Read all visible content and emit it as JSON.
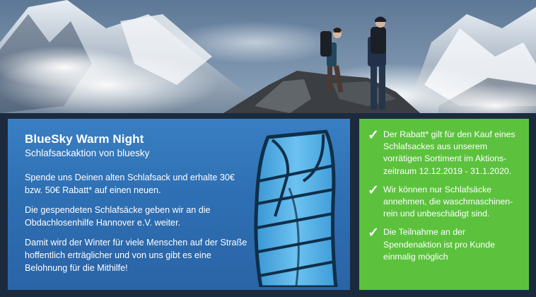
{
  "banner": {
    "title": "BlueSky Warm Night",
    "subtitle": "Schlafsackaktion von bluesky",
    "paragraph_1": "Spende uns Deinen alten Schlafsack und erhalte 30€ bzw. 50€ Rabatt* auf einen neuen.",
    "paragraph_2": "Die gespendeten Schlafsäcke geben wir an die Obdachlosenhilfe Hannover e.V. weiter.",
    "paragraph_3": "Damit wird der Winter für viele Menschen auf der Straße hoffentlich erträglicher und von uns gibt es eine Belohnung für die Mithilfe!"
  },
  "conditions": {
    "check_glyph": "✓",
    "items": [
      "Der Rabatt* gilt für den Kauf eines Schlafsackes aus unserem vorrätigen Sortiment im Aktions-zeitraum 12.12.2019 - 31.1.2020.",
      "Wir können nur Schlafsäcke annehmen, die waschmaschinen-rein und unbeschädigt sind.",
      "Die Teilnahme an der Spendenaktion ist pro Kunde einmalig möglich"
    ]
  },
  "colors": {
    "blue_panel": "#2e6fb3",
    "green_panel": "#5cc23e",
    "bag_light": "#5fb6ea",
    "bag_dark": "#16405f"
  },
  "icons": {
    "check": "check-icon",
    "sleeping_bag": "sleeping-bag-icon"
  }
}
